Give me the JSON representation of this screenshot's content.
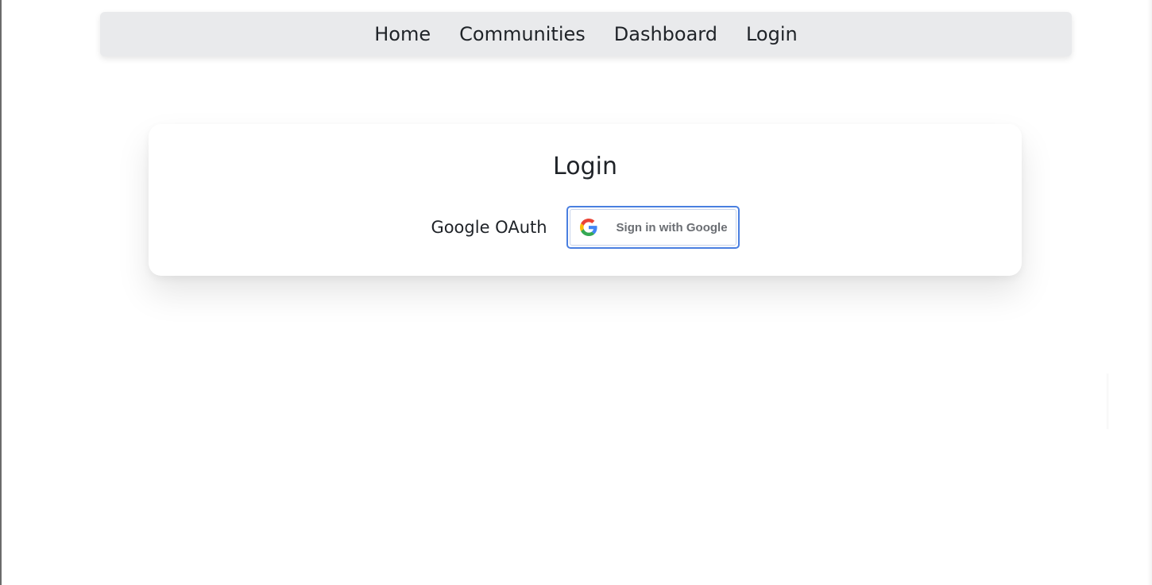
{
  "navbar": {
    "items": [
      {
        "label": "Home"
      },
      {
        "label": "Communities"
      },
      {
        "label": "Dashboard"
      },
      {
        "label": "Login"
      }
    ]
  },
  "login_card": {
    "title": "Login",
    "oauth_label": "Google OAuth",
    "google_button": {
      "label": "Sign in with Google",
      "icon": "google-g-icon"
    }
  },
  "colors": {
    "navbar_bg": "#e9eaec",
    "button_focus_border": "#4a7fe0",
    "google_blue": "#4285F4",
    "google_red": "#EA4335",
    "google_yellow": "#FBBC05",
    "google_green": "#34A853"
  }
}
